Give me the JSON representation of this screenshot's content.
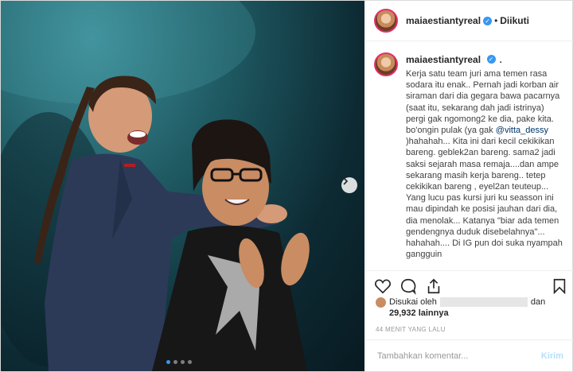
{
  "header": {
    "username": "maiaestiantyreal",
    "separator": "•",
    "follow_status": "Diikuti"
  },
  "caption": {
    "username": "maiaestiantyreal",
    "suffix": ".",
    "text_before_mention": "Kerja satu team juri ama temen rasa sodara itu enak.. Pernah jadi korban air siraman dari dia gegara bawa pacarnya (saat itu, sekarang dah jadi istrinya) pergi gak ngomong2 ke dia, pake kita. bo'ongin pulak (ya gak ",
    "mention": "@vitta_dessy",
    "text_after_mention": " )hahahah... Kita ini dari kecil cekikikan bareng. geblek2an bareng. sama2 jadi saksi sejarah masa remaja....dan ampe sekarang masih kerja bareng.. tetep cekikikan bareng , eyel2an teuteup... Yang lucu pas kursi juri ku seasson ini mau dipindah ke posisi jauhan dari dia, dia menolak... Katanya \"biar ada temen gendengnya duduk disebelahnya\"... hahahah.... Di IG pun doi suka nyampah gangguin"
  },
  "likes": {
    "prefix": "Disukai oleh",
    "connector": "dan",
    "count": "29,932 lainnya"
  },
  "timestamp": "44 MENIT YANG LALU",
  "add_comment": {
    "placeholder": "Tambahkan komentar...",
    "post_label": "Kirim"
  },
  "carousel": {
    "total": 4,
    "active_index": 0
  },
  "icons": {
    "verified": "verified-badge-icon",
    "like": "heart-icon",
    "comment": "comment-icon",
    "share": "share-icon",
    "save": "bookmark-icon",
    "next": "chevron-right-icon"
  },
  "colors": {
    "verified": "#3897f0",
    "active_dot": "#3897f0",
    "post_button": "#b2dffc",
    "mention": "#003569"
  }
}
